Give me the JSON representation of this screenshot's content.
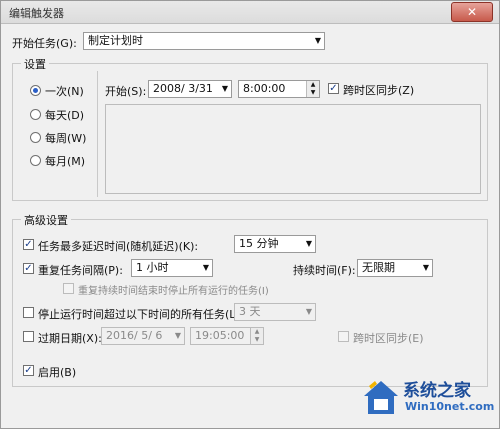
{
  "window": {
    "title": "编辑触发器",
    "close_glyph": "✕"
  },
  "start_task": {
    "label": "开始任务(G):",
    "value": "制定计划时"
  },
  "settings": {
    "legend": "设置",
    "radios": [
      {
        "label": "一次(N)",
        "selected": true
      },
      {
        "label": "每天(D)",
        "selected": false
      },
      {
        "label": "每周(W)",
        "selected": false
      },
      {
        "label": "每月(M)",
        "selected": false
      }
    ],
    "start_label": "开始(S):",
    "start_date": "2008/ 3/31",
    "start_time": "8:00:00",
    "sync_timezone": {
      "label": "跨时区同步(Z)",
      "checked": true
    }
  },
  "advanced": {
    "legend": "高级设置",
    "delay": {
      "label": "任务最多延迟时间(随机延迟)(K):",
      "checked": true,
      "value": "15 分钟"
    },
    "repeat": {
      "label": "重复任务间隔(P):",
      "checked": true,
      "value": "1 小时"
    },
    "duration": {
      "label": "持续时间(F):",
      "value": "无限期"
    },
    "stop_at_end": {
      "label": "重复持续时间结束时停止所有运行的任务(I)",
      "checked": false
    },
    "stop_longer": {
      "label": "停止运行时间超过以下时间的所有任务(L):",
      "checked": false,
      "value": "3 天"
    },
    "expire": {
      "label": "过期日期(X):",
      "checked": false,
      "date": "2016/ 5/ 6",
      "time": "19:05:00"
    },
    "expire_sync": {
      "label": "跨时区同步(E)",
      "checked": false
    },
    "enabled": {
      "label": "启用(B)",
      "checked": true
    }
  },
  "watermark": {
    "text": "系统之家",
    "url": "Win10net.com"
  },
  "colors": {
    "accent": "#2b5fc7",
    "brand": "#1e4e9a",
    "close": "#c75a4b"
  }
}
